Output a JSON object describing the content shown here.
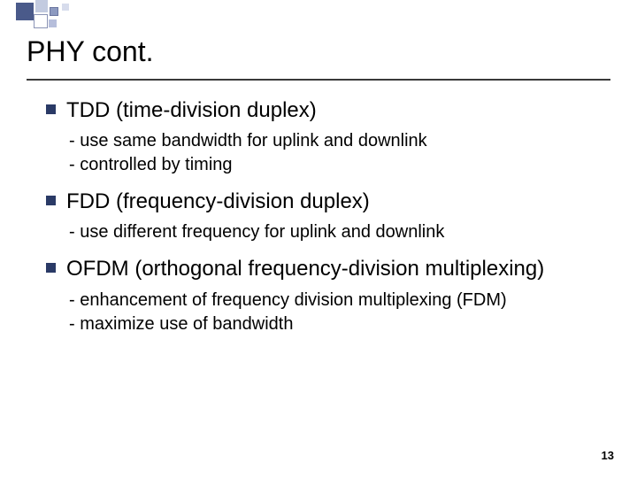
{
  "title": "PHY cont.",
  "items": [
    {
      "heading": "TDD (time-division duplex)",
      "subs": [
        "- use same bandwidth for uplink and downlink",
        "- controlled by timing"
      ]
    },
    {
      "heading": "FDD (frequency-division duplex)",
      "subs": [
        "- use different frequency for uplink and downlink"
      ]
    },
    {
      "heading": "OFDM (orthogonal frequency-division multiplexing)",
      "subs": [
        "- enhancement of frequency division multiplexing (FDM)",
        "- maximize use of bandwidth"
      ]
    }
  ],
  "page_number": "13"
}
